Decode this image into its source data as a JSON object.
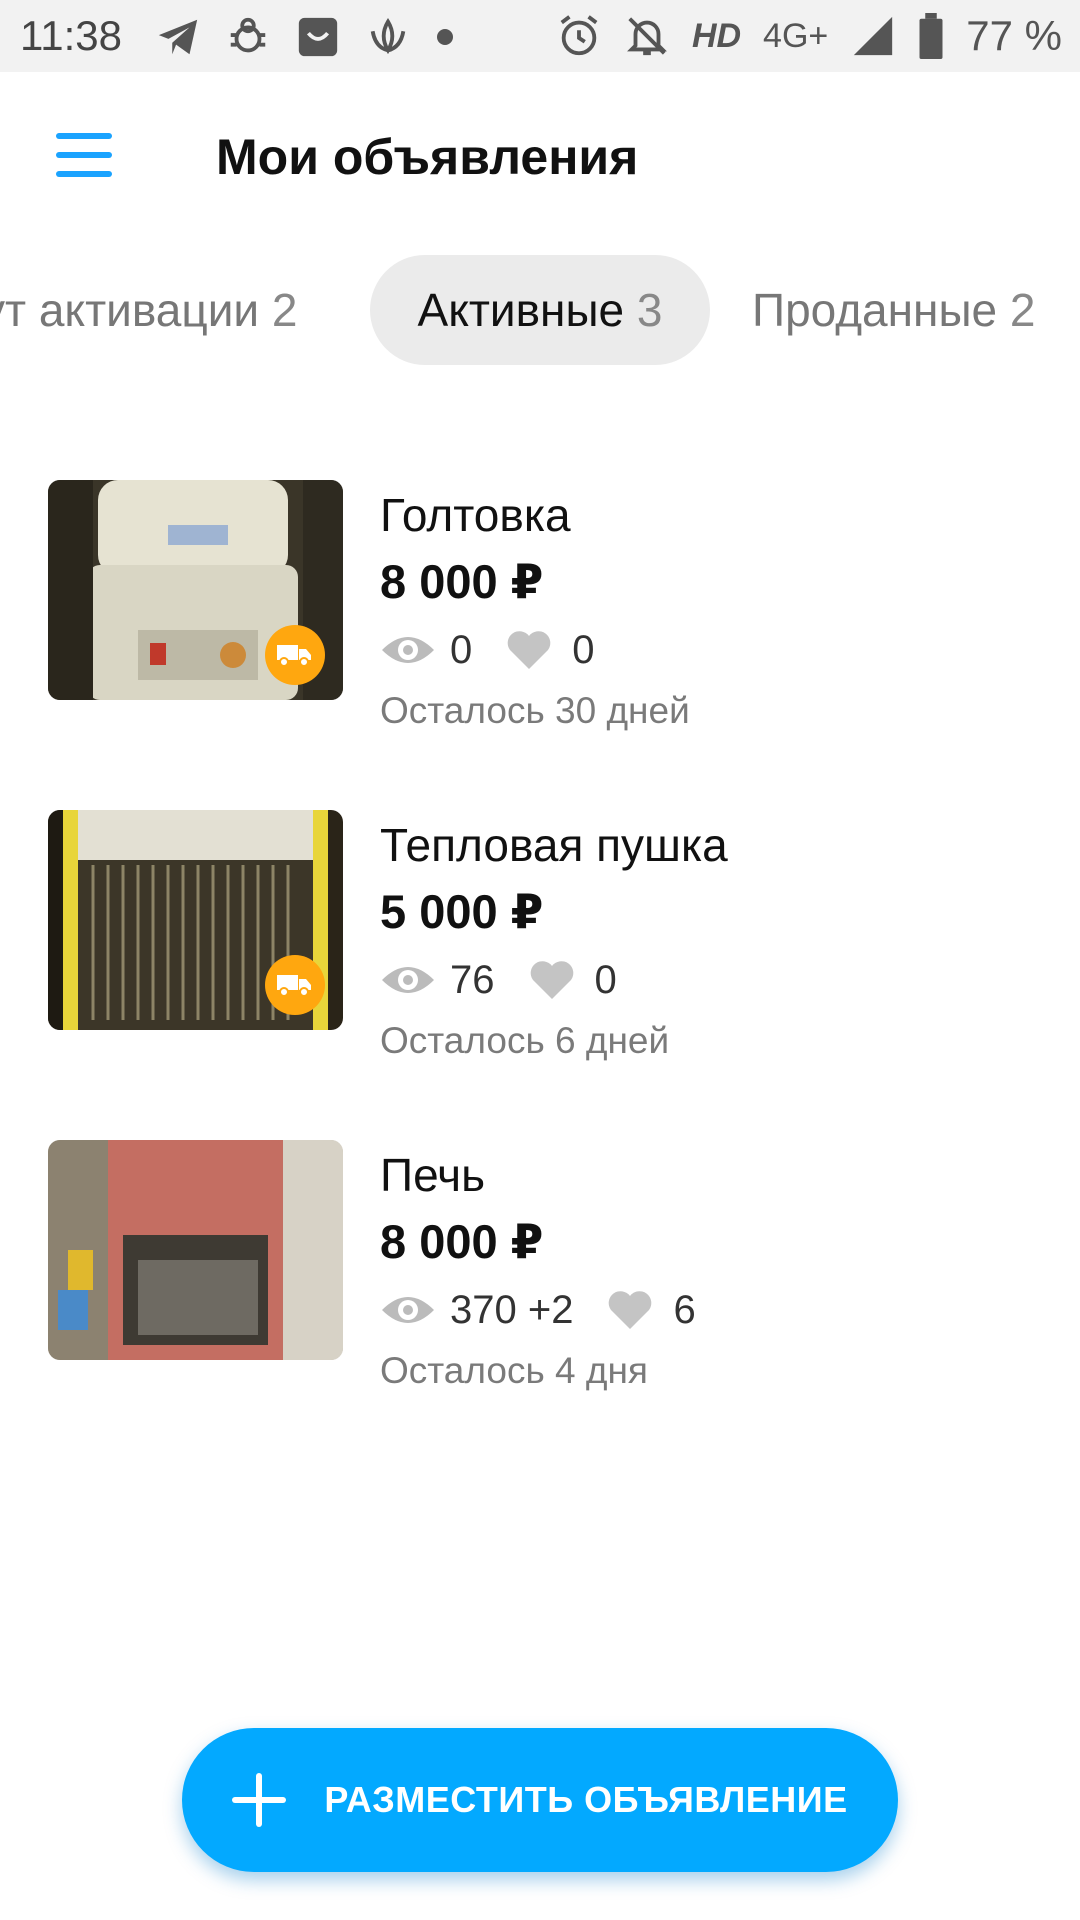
{
  "status_bar": {
    "time": "11:38",
    "left_icons": [
      "telegram-icon",
      "bug-icon",
      "shopping-bag-icon",
      "lotus-icon",
      "dot-icon"
    ],
    "right_icons": [
      "alarm-icon",
      "mute-icon",
      "signal-icon",
      "battery-icon"
    ],
    "hd": "HD",
    "network": "4G+",
    "battery": "77 %"
  },
  "header": {
    "title": "Мои объявления"
  },
  "tabs": [
    {
      "label": "Ждут активации",
      "visible_label": "ут активации",
      "count": "2"
    },
    {
      "label": "Активные",
      "count": "3"
    },
    {
      "label": "Проданные",
      "count": "2"
    }
  ],
  "listings": [
    {
      "title": "Голтовка",
      "price": "8 000 ₽",
      "views": "0",
      "likes": "0",
      "remaining": "Осталось 30 дней",
      "delivery": true
    },
    {
      "title": "Тепловая пушка",
      "price": "5 000 ₽",
      "views": "76",
      "likes": "0",
      "remaining": "Осталось 6 дней",
      "delivery": true
    },
    {
      "title": "Печь",
      "price": "8 000 ₽",
      "views": "370 +2",
      "likes": "6",
      "remaining": "Осталось 4 дня",
      "delivery": false
    }
  ],
  "fab": {
    "label": "РАЗМЕСТИТЬ ОБЪЯВЛЕНИЕ"
  },
  "colors": {
    "accent": "#03a9ff",
    "delivery_badge": "#ffa70f",
    "tab_active_bg": "#ebebeb"
  }
}
